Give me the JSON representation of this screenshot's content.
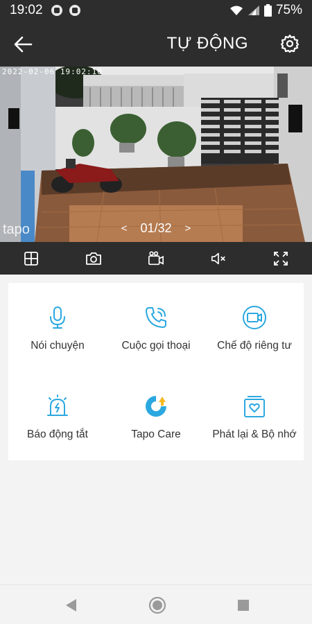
{
  "status_bar": {
    "time": "19:02",
    "battery": "75%"
  },
  "header": {
    "title": "TỰ ĐỘNG"
  },
  "camera": {
    "timestamp": "2022-02-06 19:02:10",
    "watermark": "tapo",
    "page_prev": "<",
    "page_indicator": "01/32",
    "page_next": ">"
  },
  "controls": [
    {
      "icon": "grid-icon"
    },
    {
      "icon": "camera-icon"
    },
    {
      "icon": "video-record-icon"
    },
    {
      "icon": "mute-icon"
    },
    {
      "icon": "fullscreen-icon"
    }
  ],
  "features": [
    {
      "label": "Nói chuyện",
      "icon": "microphone-icon"
    },
    {
      "label": "Cuộc gọi thoại",
      "icon": "phone-call-icon"
    },
    {
      "label": "Chế độ riêng tư",
      "icon": "privacy-camera-icon"
    },
    {
      "label": "Báo động tắt",
      "icon": "alarm-icon"
    },
    {
      "label": "Tapo Care",
      "icon": "tapo-care-icon"
    },
    {
      "label": "Phát lại & Bộ nhớ",
      "icon": "playback-icon"
    }
  ],
  "colors": {
    "accent": "#2ba8e0",
    "care_yellow": "#f5b921",
    "dark_bar": "#2d2d2d"
  }
}
